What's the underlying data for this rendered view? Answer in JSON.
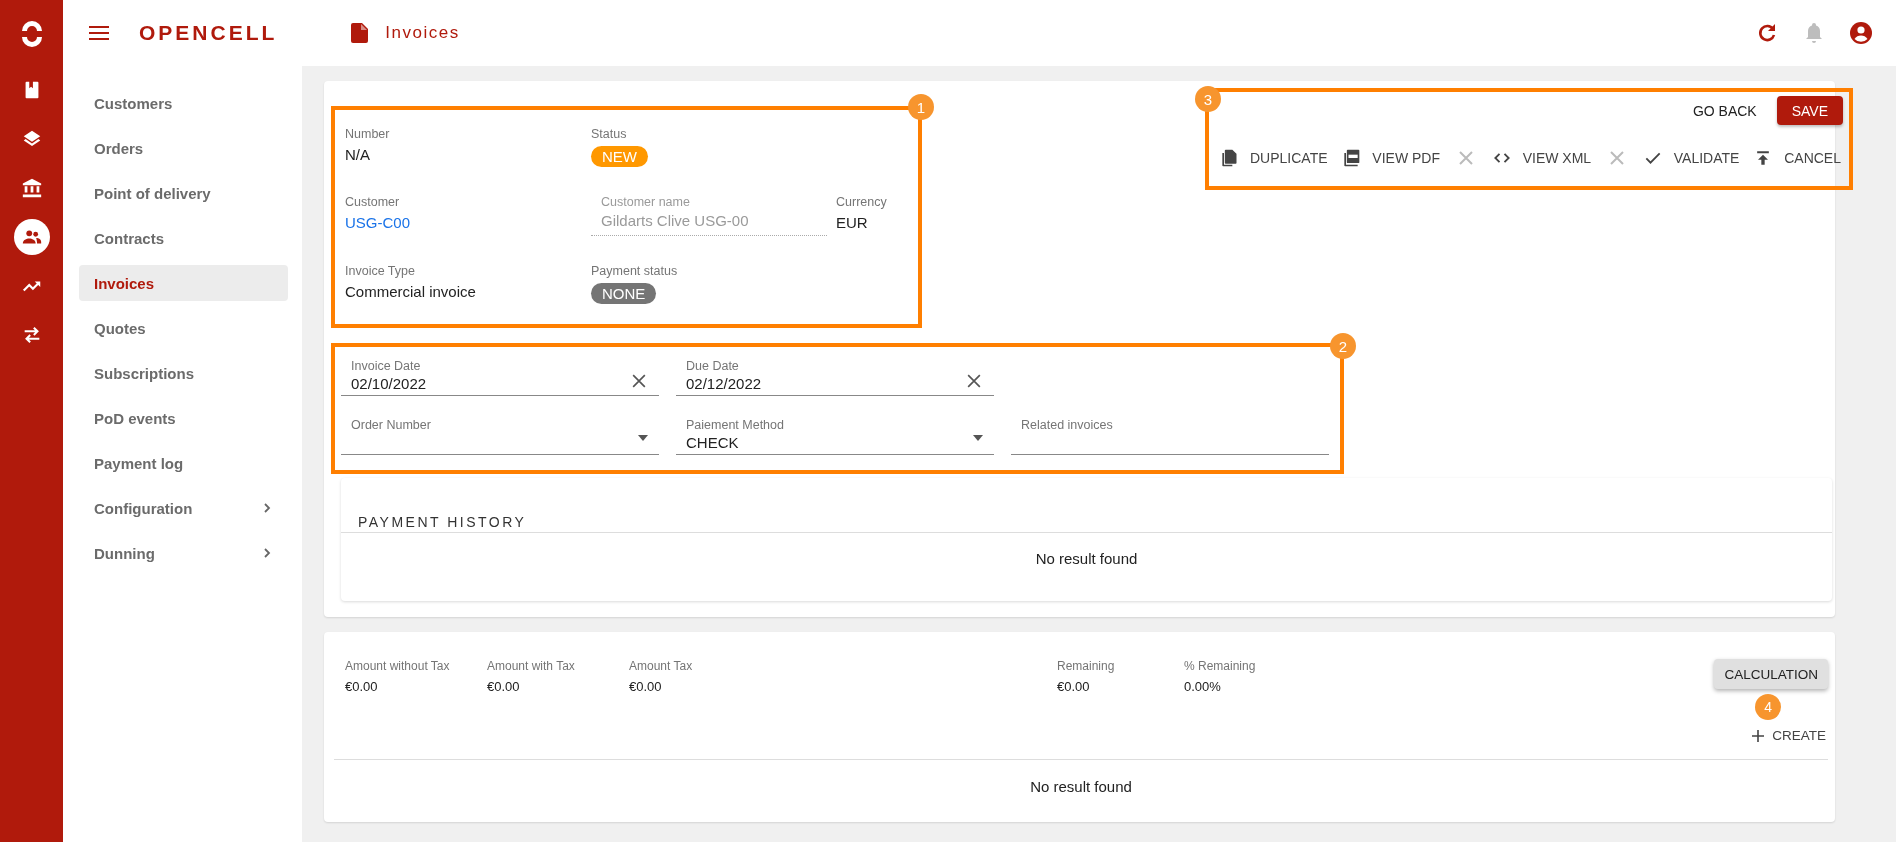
{
  "rail": [
    {
      "selected": false
    },
    {
      "selected": false
    },
    {
      "selected": false
    },
    {
      "selected": true
    },
    {
      "selected": false
    },
    {
      "selected": false
    }
  ],
  "header": {
    "logo": "OPENCELL",
    "title": "Invoices"
  },
  "nav": [
    {
      "kind": "link",
      "label": "Customers",
      "selected": false
    },
    {
      "kind": "link",
      "label": "Orders",
      "selected": false
    },
    {
      "kind": "link",
      "label": "Point of delivery",
      "selected": false
    },
    {
      "kind": "link",
      "label": "Contracts",
      "selected": false
    },
    {
      "kind": "link",
      "label": "Invoices",
      "selected": true
    },
    {
      "kind": "link",
      "label": "Quotes",
      "selected": false
    },
    {
      "kind": "link",
      "label": "Subscriptions",
      "selected": false
    },
    {
      "kind": "link",
      "label": "PoD events",
      "selected": false
    },
    {
      "kind": "link",
      "label": "Payment log",
      "selected": false
    },
    {
      "kind": "group",
      "label": "Configuration",
      "selected": false,
      "expanded": false
    },
    {
      "kind": "group",
      "label": "Dunning",
      "selected": false,
      "expanded": false
    }
  ],
  "invoice_info": {
    "callout": "1",
    "rows": [
      [
        {
          "kind": "text",
          "label": "Number",
          "value": "N/A"
        },
        {
          "kind": "badge",
          "label": "Status",
          "value": "NEW",
          "color": "#ff9800"
        }
      ],
      [
        {
          "kind": "link",
          "label": "Customer",
          "value": "USG-C00"
        },
        {
          "kind": "input",
          "label": "Customer name",
          "value": "Gildarts Clive USG-00",
          "disabled": true
        },
        {
          "kind": "text",
          "label": "Currency",
          "value": "EUR"
        }
      ],
      [
        {
          "kind": "text",
          "label": "Invoice Type",
          "value": "Commercial invoice"
        },
        {
          "kind": "badge",
          "label": "Payment status",
          "value": "NONE",
          "color": "#757575"
        }
      ]
    ]
  },
  "dates": {
    "callout": "2",
    "rows": [
      [
        {
          "kind": "date",
          "label": "Invoice Date",
          "value": "02/10/2022"
        },
        {
          "kind": "date",
          "label": "Due Date",
          "value": "02/12/2022"
        }
      ],
      [
        {
          "kind": "select",
          "label": "Order Number"
        },
        {
          "kind": "select",
          "label": "Paiement Method",
          "value": "CHECK"
        },
        {
          "kind": "input",
          "label": "Related invoices"
        }
      ]
    ]
  },
  "actions": {
    "callout": "3",
    "top": [
      {
        "kind": "text",
        "label": "GO BACK"
      },
      {
        "kind": "primary",
        "label": "SAVE"
      }
    ],
    "toolbar": [
      {
        "kind": "action",
        "label": "DUPLICATE"
      },
      {
        "kind": "action",
        "label": "VIEW PDF"
      },
      {
        "kind": "clear",
        "disabled": true
      },
      {
        "kind": "action",
        "label": "VIEW XML"
      },
      {
        "kind": "clear",
        "disabled": true
      },
      {
        "kind": "action",
        "label": "VALIDATE"
      },
      {
        "kind": "action",
        "label": "CANCEL"
      }
    ]
  },
  "payment_history": {
    "title": "PAYMENT HISTORY",
    "empty": "No result found"
  },
  "totals": {
    "amounts": [
      {
        "label": "Amount without Tax",
        "value": "€0.00"
      },
      {
        "label": "Amount with Tax",
        "value": "€0.00"
      },
      {
        "label": "Amount Tax",
        "value": "€0.00"
      }
    ],
    "remaining": [
      {
        "label": "Remaining",
        "value": "€0.00"
      },
      {
        "label": "% Remaining",
        "value": "0.00%"
      }
    ],
    "calculate": "CALCULATION",
    "create": "CREATE",
    "callout": "4",
    "empty": "No result found"
  }
}
